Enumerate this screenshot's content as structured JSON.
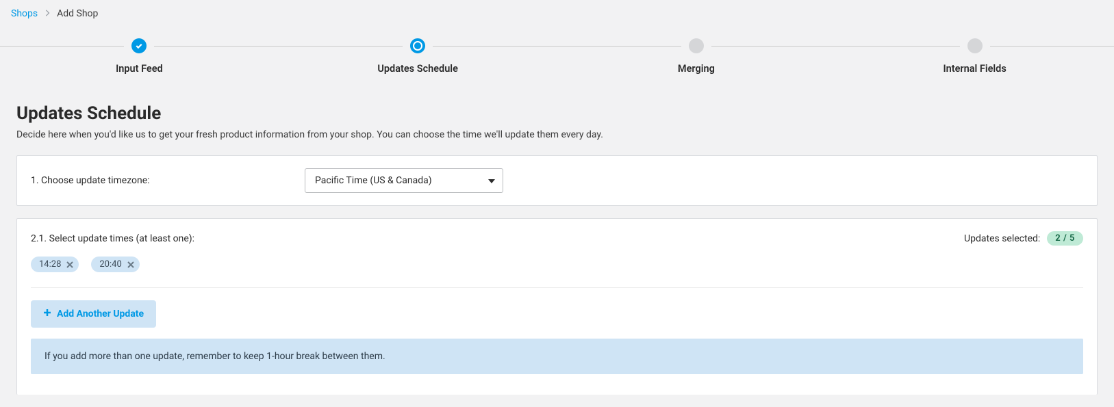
{
  "breadcrumb": {
    "parent": "Shops",
    "current": "Add Shop"
  },
  "steps": [
    {
      "label": "Input Feed",
      "status": "done"
    },
    {
      "label": "Updates Schedule",
      "status": "active"
    },
    {
      "label": "Merging",
      "status": "todo"
    },
    {
      "label": "Internal Fields",
      "status": "todo"
    }
  ],
  "page": {
    "title": "Updates Schedule",
    "subtitle": "Decide here when you'd like us to get your fresh product information from your shop. You can choose the time we'll update them every day."
  },
  "timezone": {
    "label": "1. Choose update timezone:",
    "value": "Pacific Time (US & Canada)"
  },
  "times": {
    "label": "2.1. Select update times (at least one):",
    "selected_caption": "Updates selected:",
    "selected_count": "2 / 5",
    "chips": [
      "14:28",
      "20:40"
    ],
    "add_label": "Add Another Update",
    "info": "If you add more than one update, remember to keep 1-hour break between them."
  }
}
